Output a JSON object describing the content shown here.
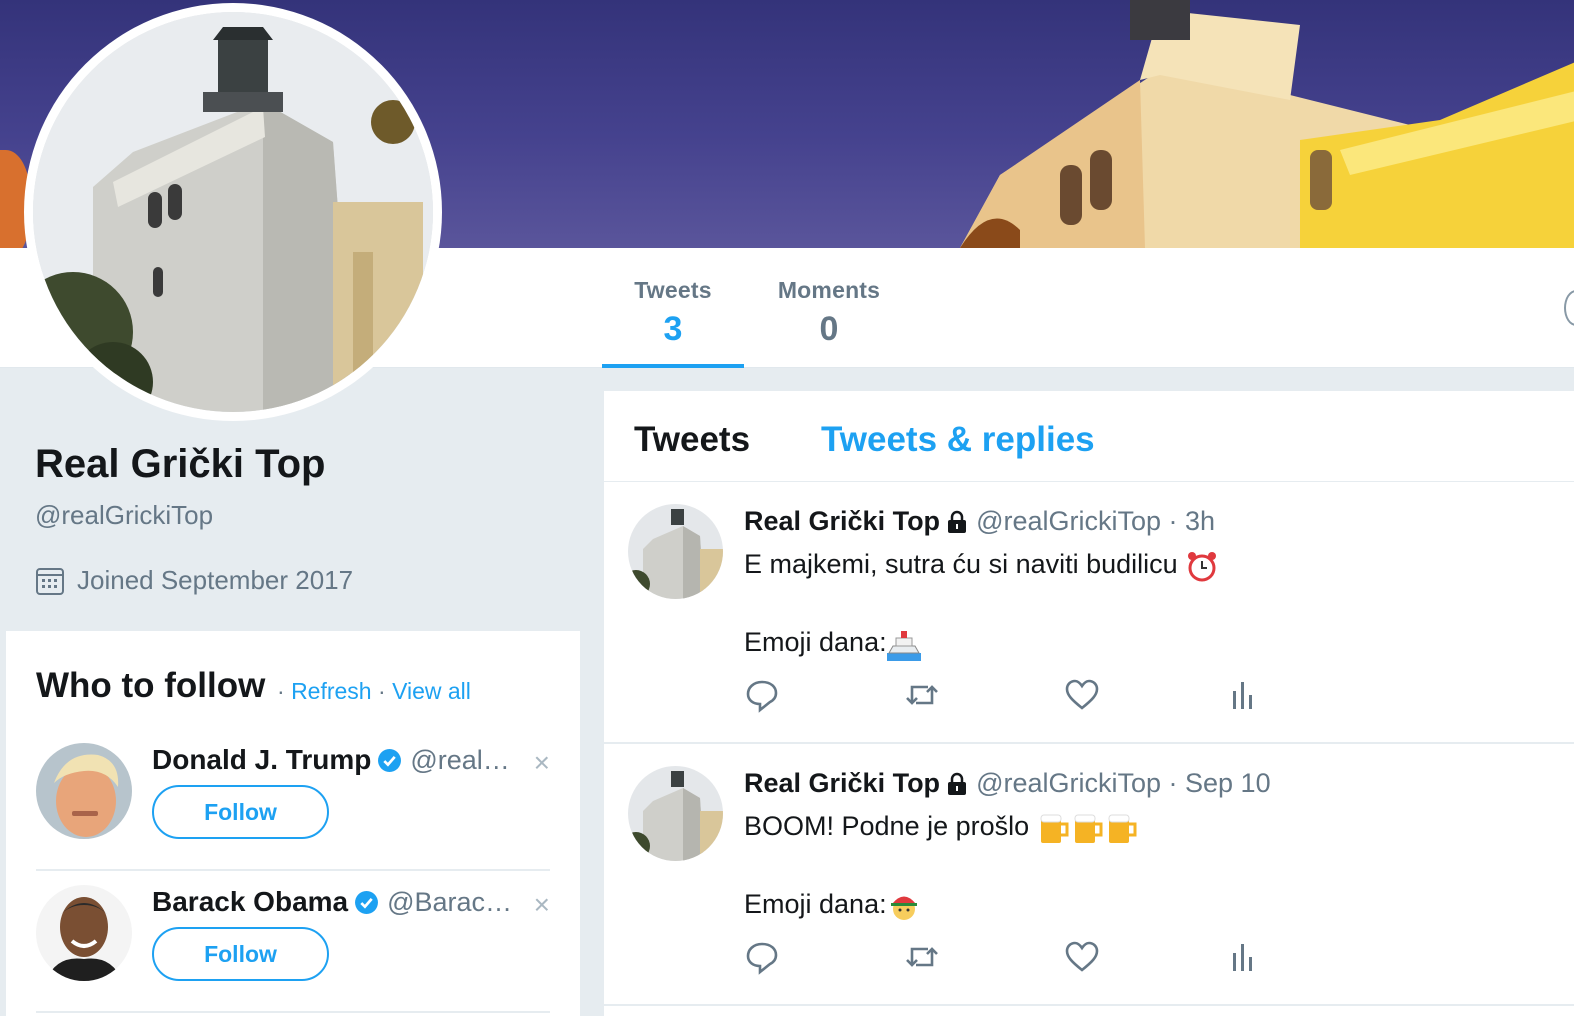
{
  "profile": {
    "name": "Real Grički Top",
    "handle": "@realGrickiTop",
    "joined": "Joined September 2017"
  },
  "nav": {
    "stats": [
      {
        "label": "Tweets",
        "value": "3"
      },
      {
        "label": "Moments",
        "value": "0"
      }
    ]
  },
  "who_to_follow": {
    "title": "Who to follow",
    "sep1": " · ",
    "refresh": "Refresh",
    "sep2": " · ",
    "view_all": "View all",
    "suggestions": [
      {
        "name": "Donald J. Trump",
        "handle": "@real…",
        "button": "Follow",
        "dismiss": "×"
      },
      {
        "name": "Barack Obama",
        "handle": "@Barac…",
        "button": "Follow",
        "dismiss": "×"
      }
    ]
  },
  "timeline": {
    "tabs": [
      "Tweets",
      "Tweets & replies"
    ],
    "tweets": [
      {
        "name": "Real Grički Top",
        "meta": "@realGrickiTop · 3h",
        "line1": "E majkemi, sutra ću si naviti budilicu",
        "line2": "Emoji dana:",
        "emoji1": "alarm-clock-emoji",
        "emoji2": "ship-emoji"
      },
      {
        "name": "Real Grički Top",
        "meta": "@realGrickiTop · Sep 10",
        "line1": "BOOM! Podne je prošlo",
        "line2": "Emoji dana:",
        "emoji1": "beer-mug-emoji",
        "emoji2": "worker-emoji"
      }
    ]
  },
  "colors": {
    "accent": "#1da1f2",
    "muted": "#657786",
    "background": "#e6ecf0"
  }
}
